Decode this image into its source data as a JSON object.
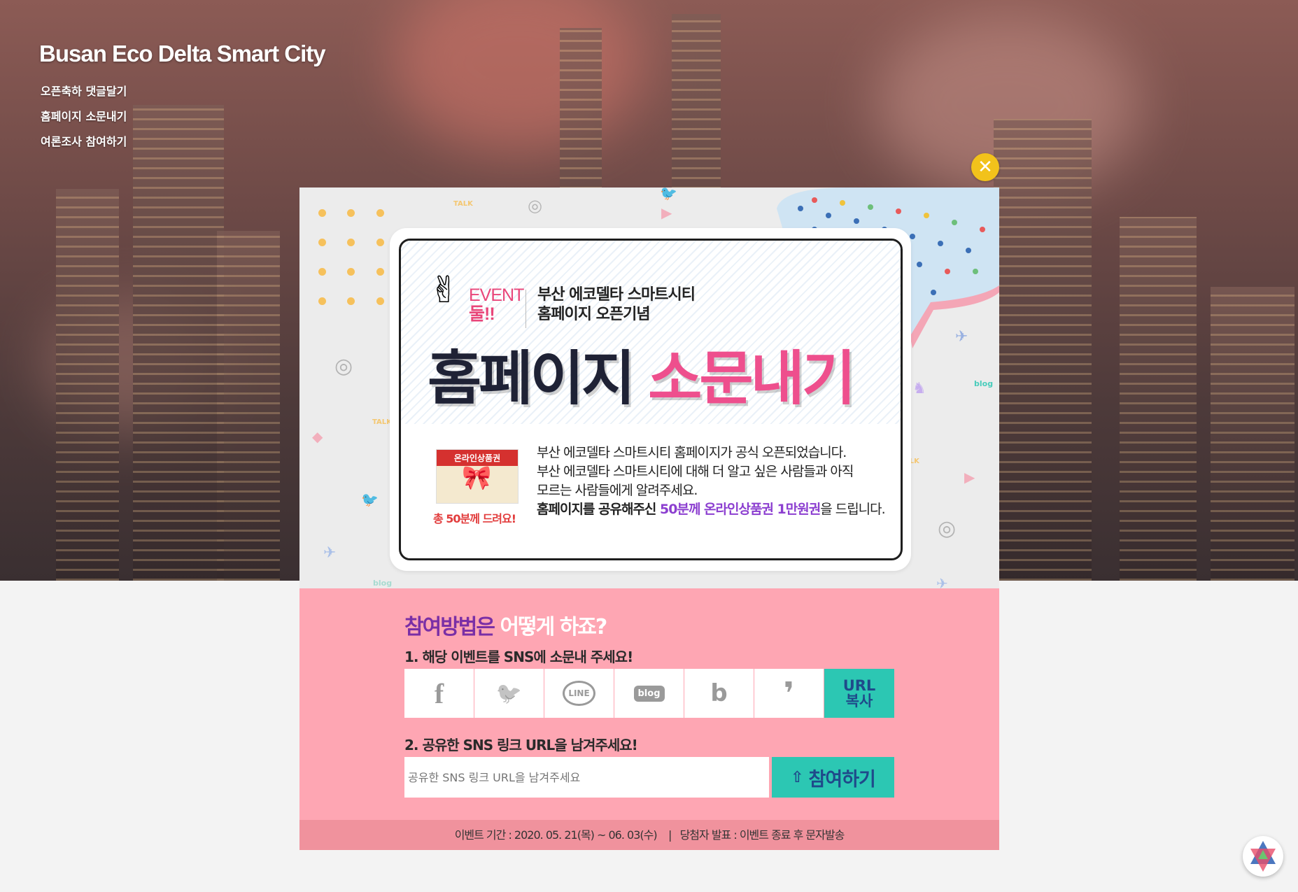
{
  "site": {
    "title": "Busan Eco Delta Smart City",
    "nav": [
      "오픈축하 댓글달기",
      "홈페이지 소문내기",
      "여론조사 참여하기"
    ]
  },
  "popup": {
    "close_icon": "close-icon",
    "event_label": "EVENT",
    "event_num": "둘!!",
    "subtitle_line1": "부산 에코델타 스마트시티",
    "subtitle_line2": "홈페이지 오픈기념",
    "headline_dark": "홈페이지",
    "headline_pink": "소문내기",
    "gift_label": "온라인상품권",
    "gift_caption": "총 50분께 드려요!",
    "desc_line1": "부산 에코델타 스마트시티 홈페이지가 공식 오픈되었습니다.",
    "desc_line2": "부산 에코델타 스마트시티에 대해 더 알고 싶은 사람들과 아직",
    "desc_line3": "모르는 사람들에게 알려주세요.",
    "desc_line4_a": "홈페이지를 공유해주신 ",
    "desc_line4_b": "50분께 온라인상품권 1만원권",
    "desc_line4_c": "을 드립니다.",
    "sns_icons": [
      "TALK",
      "blog",
      "TALK",
      "TALK",
      "blog",
      "blog"
    ]
  },
  "howto": {
    "question_a": "참여방법은",
    "question_b": "어떻게 하죠?",
    "step1": "1. 해당 이벤트를 SNS에 소문내 주세요!",
    "sns_buttons": [
      {
        "name": "facebook",
        "glyph": "f"
      },
      {
        "name": "twitter",
        "glyph": "🐦"
      },
      {
        "name": "line",
        "glyph": "LINE"
      },
      {
        "name": "blog",
        "glyph": "blog"
      },
      {
        "name": "band",
        "glyph": "b"
      },
      {
        "name": "kakaostory",
        "glyph": "❜"
      }
    ],
    "url_copy": "URL 복사",
    "step2": "2. 공유한 SNS 링크 URL을 남겨주세요!",
    "input_placeholder": "공유한 SNS 링크 URL을 남겨주세요",
    "join_button": "참여하기"
  },
  "footer": {
    "period": "이벤트 기간 : 2020. 05. 21(목) ~ 06. 03(수)    |   당첨자 발표 : 이벤트 종료 후 문자발송"
  },
  "colors": {
    "accent_teal": "#2cc7b3",
    "pink": "#fea6b3",
    "headline_pink": "#ee4f8d",
    "close_yellow": "#f2c21b"
  }
}
